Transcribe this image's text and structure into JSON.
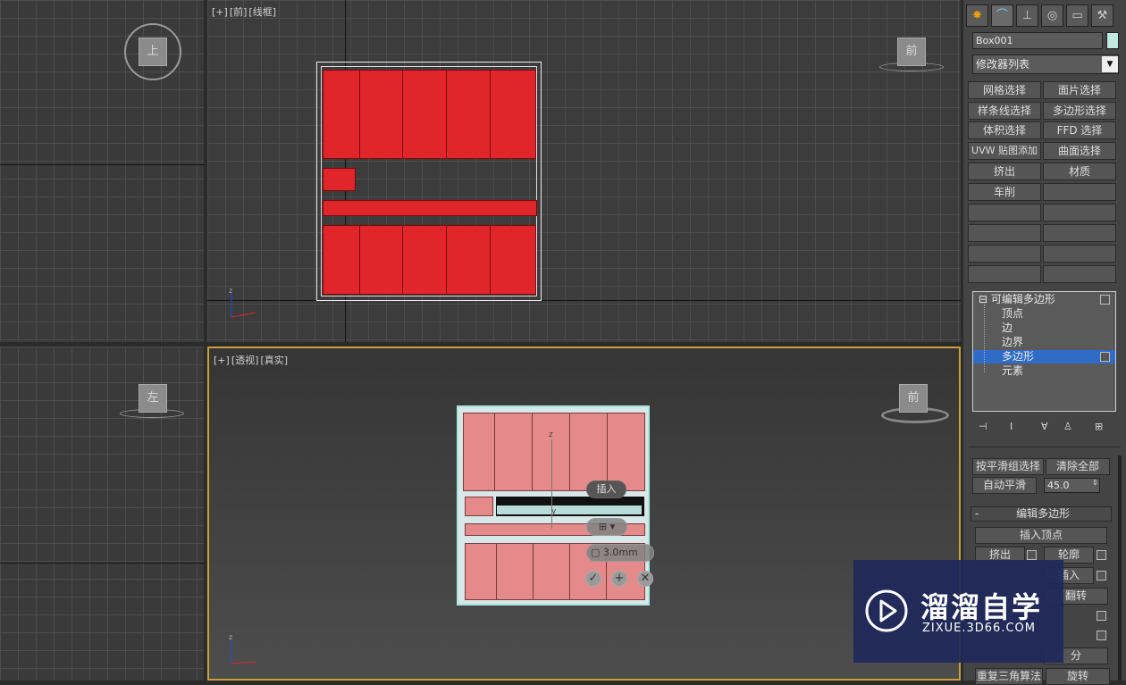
{
  "viewports": {
    "top": {
      "label": "上"
    },
    "front": {
      "label": [
        "[+]",
        "[前]",
        "[线框]"
      ],
      "cube": "前"
    },
    "left": {
      "cube": "左"
    },
    "perspective": {
      "label": [
        "[+]",
        "[透视]",
        "[真实]"
      ],
      "cube": "前",
      "axis_z": "z",
      "axis_y": "y"
    }
  },
  "caddy": {
    "title": "插入",
    "value": "3.0mm",
    "icons": [
      "mode-dropdown-icon",
      "ok-icon",
      "apply-icon",
      "cancel-icon"
    ]
  },
  "panel": {
    "tabs": [
      "create-tab-icon",
      "modify-tab-icon",
      "hierarchy-tab-icon",
      "motion-tab-icon",
      "display-tab-icon",
      "utilities-tab-icon"
    ],
    "object_name": "Box001",
    "modifier_list": "修改器列表",
    "modifier_buttons": [
      [
        "网格选择",
        "面片选择"
      ],
      [
        "样条线选择",
        "多边形选择"
      ],
      [
        "体积选择",
        "FFD 选择"
      ],
      [
        "UVW 贴图添加",
        "曲面选择"
      ],
      [
        "挤出",
        "材质"
      ],
      [
        "车削",
        ""
      ]
    ],
    "stack": {
      "root": "可编辑多边形",
      "items": [
        "顶点",
        "边",
        "边界",
        "多边形",
        "元素"
      ],
      "selected_index": 3
    },
    "smoothing": {
      "by_smoothing_group": "按平滑组选择",
      "clear_all": "清除全部",
      "auto_smooth": "自动平滑",
      "angle": "45.0"
    },
    "edit_poly": {
      "header_toggle": "-",
      "title": "编辑多边形",
      "insert_vertex": "插入顶点",
      "extrude": "挤出",
      "outline": "轮廓",
      "inset": "插入",
      "flip": "翻转",
      "subdivide": "分",
      "retriangulate": "重复三角算法",
      "turn": "旋转"
    }
  },
  "watermark": {
    "brand": "溜溜自学",
    "url": "ZIXUE.3D66.COM"
  },
  "colors": {
    "accent_select": "#2f6cc8",
    "poly_red": "#e0252b",
    "poly_light": "#e58a8a",
    "active_border": "#c8a13a"
  }
}
